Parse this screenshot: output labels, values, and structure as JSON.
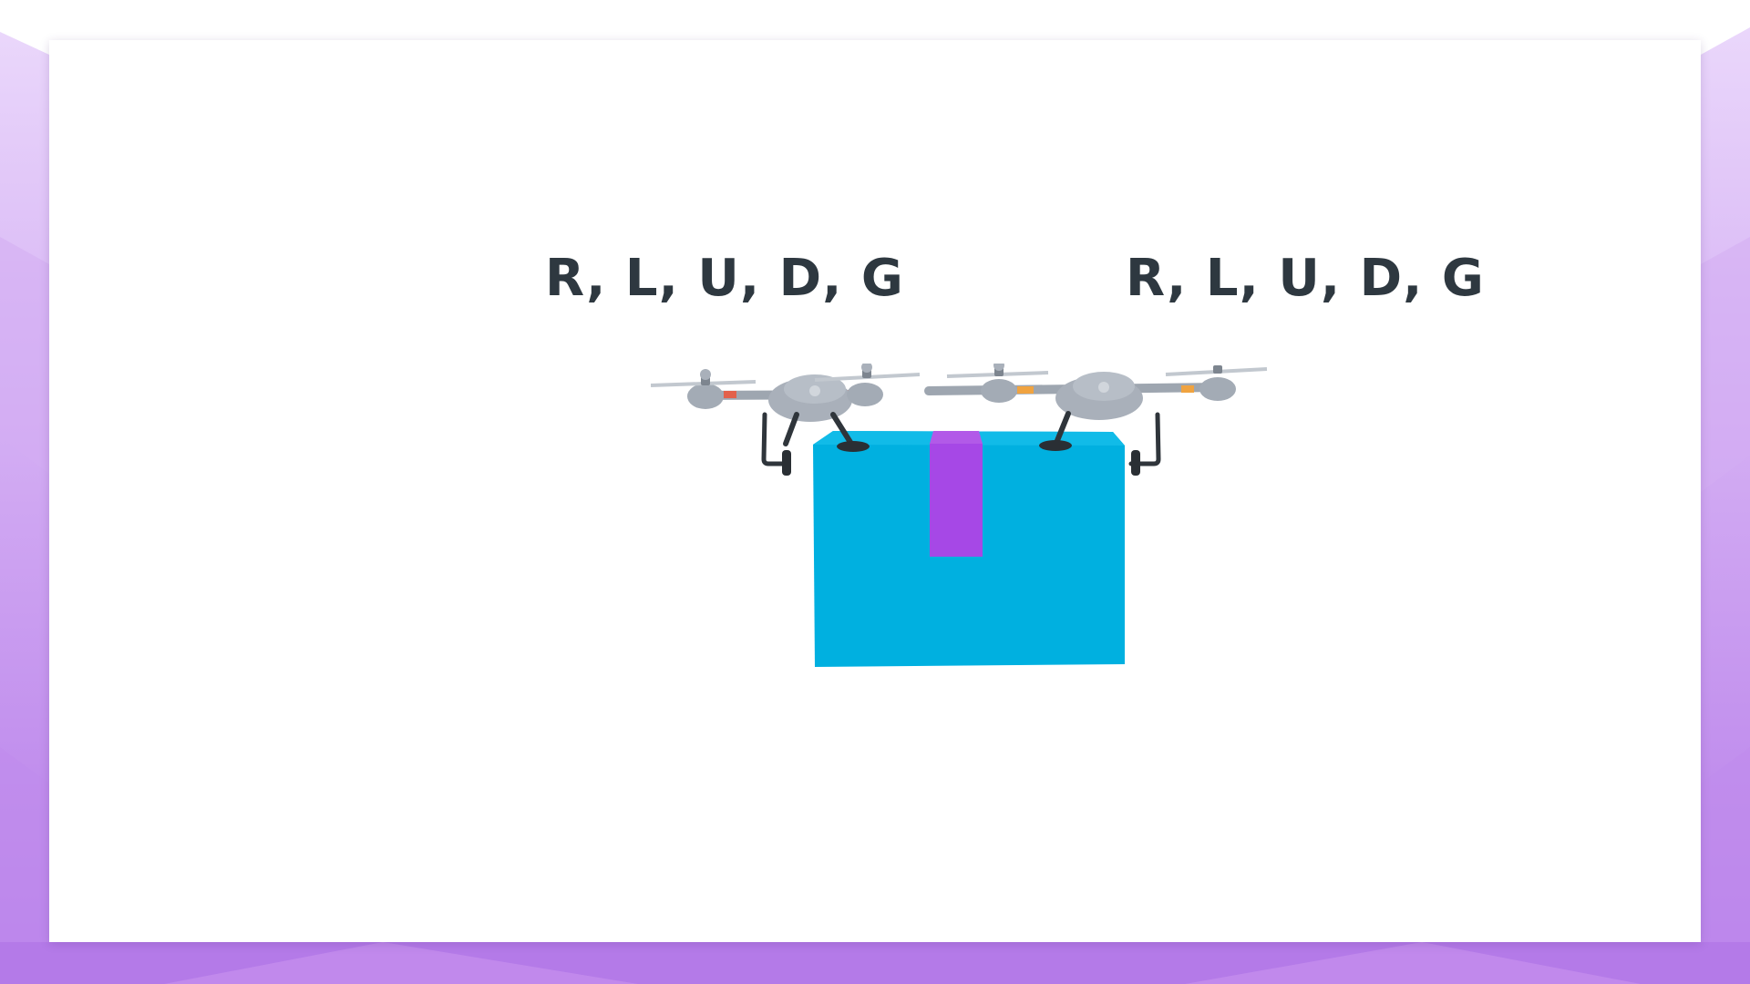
{
  "slide": {
    "left_drone_label": "R, L, U, D, G",
    "right_drone_label": "R, L, U, D, G"
  },
  "colors": {
    "background_accent": "#b37be8",
    "package": "#00b0e0",
    "package_tape": "#a648e6",
    "drone_body": "#a9b0ba",
    "label_text": "#2e3840"
  },
  "icons": [
    "drone-icon",
    "package-icon"
  ]
}
